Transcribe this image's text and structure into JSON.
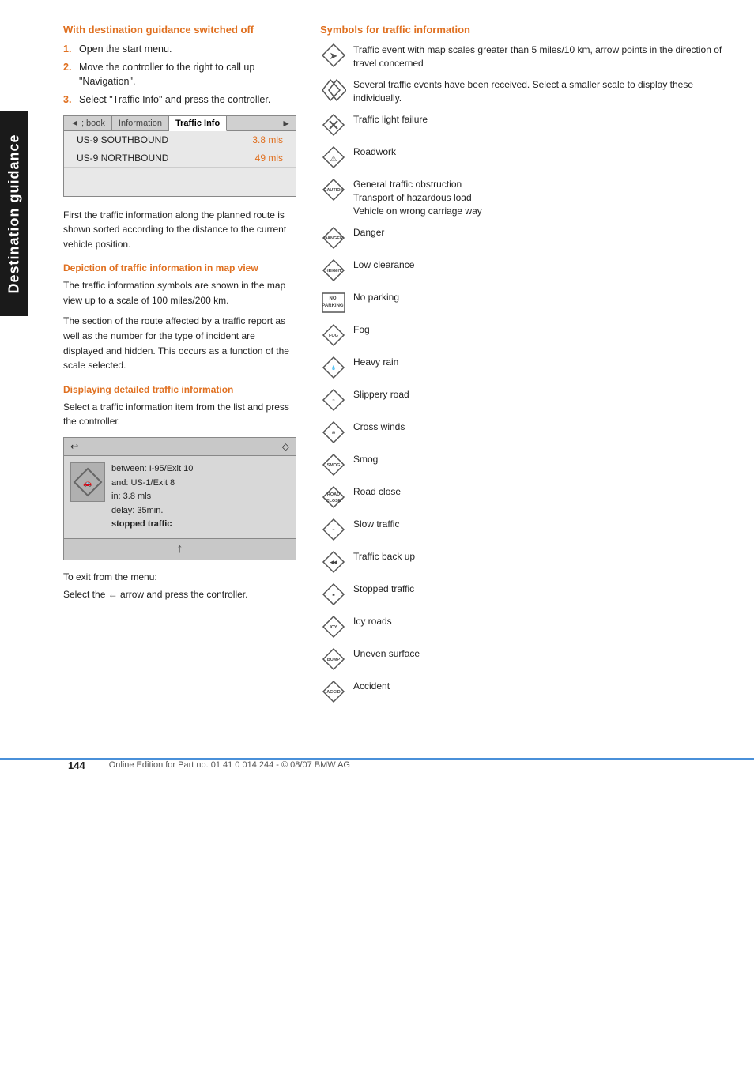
{
  "sidebar": {
    "label": "Destination guidance"
  },
  "left_col": {
    "heading": "With destination guidance switched off",
    "steps": [
      "Open the start menu.",
      "Move the controller to the right to call up \"Navigation\".",
      "Select \"Traffic Info\" and press the controller."
    ],
    "ui_mockup": {
      "tabs": [
        "◄ ; book",
        "Information",
        "Traffic Info",
        "►"
      ],
      "active_tab": "Traffic Info",
      "rows": [
        {
          "name": "US-9 SOUTHBOUND",
          "distance": "3.8 mls"
        },
        {
          "name": "US-9 NORTHBOUND",
          "distance": "49 mls"
        }
      ]
    },
    "first_traffic_text": "First the traffic information along the planned route is shown sorted according to the distance to the current vehicle position.",
    "depiction_heading": "Depiction of traffic information in map view",
    "depiction_text1": "The traffic information symbols are shown in the map view up to a scale of 100 miles/200 km.",
    "depiction_text2": "The section of the route affected by a traffic report as well as the number for the type of incident are displayed and hidden. This occurs as a function of the scale selected.",
    "displaying_heading": "Displaying detailed traffic information",
    "displaying_text": "Select a traffic information item from the list and press the controller.",
    "detail_mockup": {
      "header_left": "↩",
      "header_right": "◇",
      "between": "between: I-95/Exit 10",
      "and": "and: US-1/Exit 8",
      "in": "in: 3.8 mls",
      "delay": "delay: 35min.",
      "type": "stopped traffic"
    },
    "exit_text1": "To exit from the menu:",
    "exit_text2": "Select the ← arrow and press the controller."
  },
  "right_col": {
    "heading": "Symbols for traffic information",
    "symbols": [
      {
        "icon_type": "arrow-diamond",
        "text": "Traffic event with map scales greater than 5 miles/10 km, arrow points in the direction of travel concerned"
      },
      {
        "icon_type": "double-diamond",
        "text": "Several traffic events have been received. Select a smaller scale to display these individually."
      },
      {
        "icon_type": "diamond-x",
        "label": "",
        "text": "Traffic light failure"
      },
      {
        "icon_type": "diamond-roadwork",
        "label": "",
        "text": "Roadwork"
      },
      {
        "icon_type": "diamond-caution",
        "label": "CAUTION",
        "text": "General traffic obstruction\nTransport of hazardous load\nVehicle on wrong carriage way"
      },
      {
        "icon_type": "diamond-danger",
        "label": "DANGER",
        "text": "Danger"
      },
      {
        "icon_type": "diamond-height",
        "label": "HEIGHT",
        "text": "Low clearance"
      },
      {
        "icon_type": "rect-nopark",
        "label": "NO\nPARK ING",
        "text": "No parking"
      },
      {
        "icon_type": "diamond-fog",
        "label": "FOG",
        "text": "Fog"
      },
      {
        "icon_type": "diamond-rain",
        "label": "",
        "text": "Heavy rain"
      },
      {
        "icon_type": "diamond-slip",
        "label": "",
        "text": "Slippery road"
      },
      {
        "icon_type": "diamond-wind",
        "label": "",
        "text": "Cross winds"
      },
      {
        "icon_type": "diamond-smog",
        "label": "SMOG",
        "text": "Smog"
      },
      {
        "icon_type": "diamond-roadclose",
        "label": "ROAD\nCLOSE",
        "text": "Road close"
      },
      {
        "icon_type": "diamond-slow",
        "label": "",
        "text": "Slow traffic"
      },
      {
        "icon_type": "diamond-backup",
        "label": "",
        "text": "Traffic back up"
      },
      {
        "icon_type": "diamond-stopped",
        "label": "",
        "text": "Stopped traffic"
      },
      {
        "icon_type": "diamond-icy",
        "label": "ICY",
        "text": "Icy roads"
      },
      {
        "icon_type": "diamond-bump",
        "label": "BUMP",
        "text": "Uneven surface"
      },
      {
        "icon_type": "diamond-accident",
        "label": "",
        "text": "Accident"
      }
    ]
  },
  "footer": {
    "page_number": "144",
    "footer_text": "Online Edition for Part no. 01 41 0 014 244 - © 08/07 BMW AG"
  }
}
